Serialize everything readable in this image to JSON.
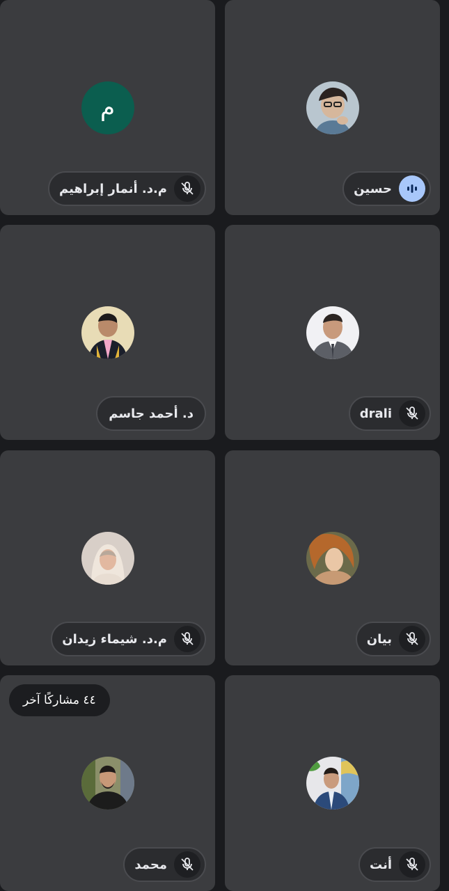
{
  "participants": [
    {
      "name": "م.د. أنمار إبراهيم",
      "mic": "muted",
      "avatar": "letter",
      "avatar_letter": "م",
      "avatar_color": "#0b5e4f"
    },
    {
      "name": "حسين",
      "mic": "speaking",
      "avatar": "photo"
    },
    {
      "name": "د. أحمد جاسم",
      "mic": "none",
      "avatar": "photo"
    },
    {
      "name": "drali",
      "mic": "muted",
      "avatar": "photo"
    },
    {
      "name": "م.د. شيماء زيدان",
      "mic": "muted",
      "avatar": "photo"
    },
    {
      "name": "بيان",
      "mic": "muted",
      "avatar": "photo"
    },
    {
      "name": "محمد",
      "mic": "muted",
      "avatar": "photo"
    },
    {
      "name": "أنت",
      "mic": "muted",
      "avatar": "photo"
    }
  ],
  "others_badge": "٤٤ مشاركًا آخر",
  "icons": {
    "muted": "mic-off-icon",
    "speaking": "audio-wave-icon"
  },
  "colors": {
    "tile_bg": "#3b3c3f",
    "page_bg": "#1a1b1e",
    "speaking_accent": "#a8c7fa",
    "letter_avatar": "#0b5e4f"
  }
}
